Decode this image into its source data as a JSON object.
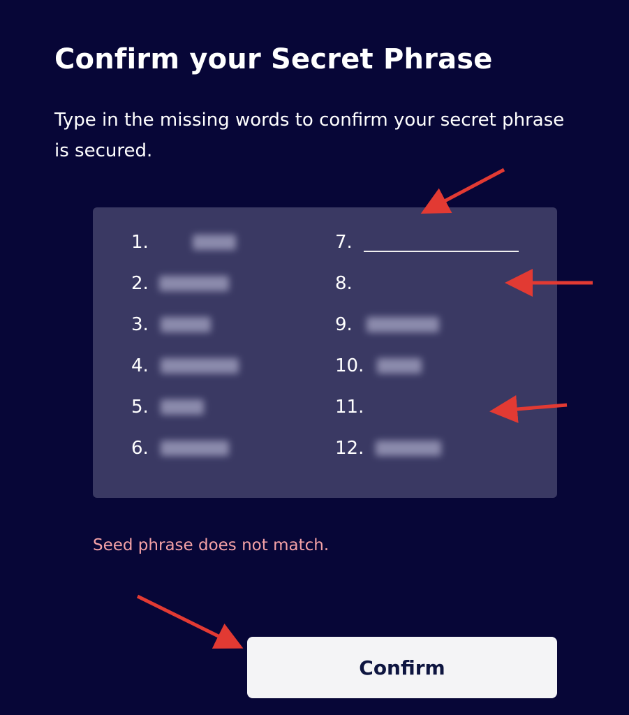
{
  "header": {
    "title": "Confirm your Secret Phrase",
    "subtitle": "Type in the missing words to confirm your secret phrase is secured."
  },
  "phrase": {
    "left_column": [
      {
        "number": "1.",
        "state": "hidden"
      },
      {
        "number": "2.",
        "state": "hidden"
      },
      {
        "number": "3.",
        "state": "hidden"
      },
      {
        "number": "4.",
        "state": "hidden"
      },
      {
        "number": "5.",
        "state": "hidden"
      },
      {
        "number": "6.",
        "state": "hidden"
      }
    ],
    "right_column": [
      {
        "number": "7.",
        "state": "input",
        "value": ""
      },
      {
        "number": "8.",
        "state": "input",
        "value": ""
      },
      {
        "number": "9.",
        "state": "hidden"
      },
      {
        "number": "10.",
        "state": "hidden"
      },
      {
        "number": "11.",
        "state": "input",
        "value": ""
      },
      {
        "number": "12.",
        "state": "hidden"
      }
    ]
  },
  "error": {
    "message": "Seed phrase does not match."
  },
  "actions": {
    "confirm_label": "Confirm"
  },
  "colors": {
    "background": "#070637",
    "card": "#3a3963",
    "error": "#f4a1a6",
    "button_bg": "#f4f4f6",
    "button_text": "#0e1540",
    "annotation_arrow": "#e23a33"
  },
  "annotations": {
    "arrow_icon": "red-arrow-icon"
  }
}
